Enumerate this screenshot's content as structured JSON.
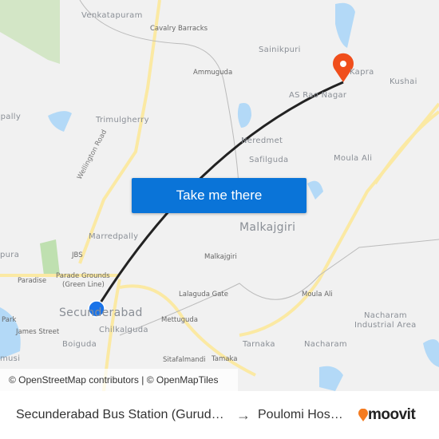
{
  "map": {
    "labels": {
      "venkatapuram": "Venkatapuram",
      "cavalry": "Cavalry Barracks",
      "sainikpuri": "Sainikpuri",
      "kapra": "Kapra",
      "kushai": "Kushai",
      "ammuguda": "Ammuguda",
      "asrao": "AS Rao Nagar",
      "pally": "npally",
      "trimulgherry": "Trimulgherry",
      "neredmet": "Neredmet",
      "safilguda": "Safilguda",
      "moulaali1": "Moula Ali",
      "wellington": "Wellington Road",
      "malkajgiri_big": "Malkajgiri",
      "marredpally": "Marredpally",
      "pura": "pura",
      "jbs": "JBS",
      "malkajgiri_sm": "Malkajgiri",
      "paradise": "Paradise",
      "parade": "Parade Grounds",
      "greenline": "(Green Line)",
      "lalaguda": "Lalaguda Gate",
      "moulaali2": "Moula Ali",
      "secunderabad": "Secunderabad",
      "park": "Park",
      "james": "James Street",
      "chilkalguda": "Chilkalguda",
      "mettuguda": "Mettuguda",
      "nacharam_ind1": "Nacharam",
      "nacharam_ind2": "Industrial Area",
      "boiguda": "Boiguda",
      "tarnaka": "Tarnaka",
      "nacharam": "Nacharam",
      "musi": "musi",
      "sitafalmandi": "Sitafalmandi",
      "tamaka": "Tamaka"
    },
    "attribution": "© OpenStreetMap contributors | © OpenMapTiles",
    "cta_label": "Take me there",
    "colors": {
      "route": "#222222",
      "origin": "#1a73e8",
      "destination": "#f04e1c",
      "button": "#0a74d8",
      "water": "#b3d9f7",
      "road": "#fbe9a3",
      "park": "#cfe5c3"
    },
    "origin_icon": "origin-dot-icon",
    "destination_icon": "map-pin-icon"
  },
  "footer": {
    "from": "Secunderabad Bus Station (Gurud…",
    "arrow": "→",
    "to": "Poulomi Hos…",
    "logo": "moovit"
  }
}
